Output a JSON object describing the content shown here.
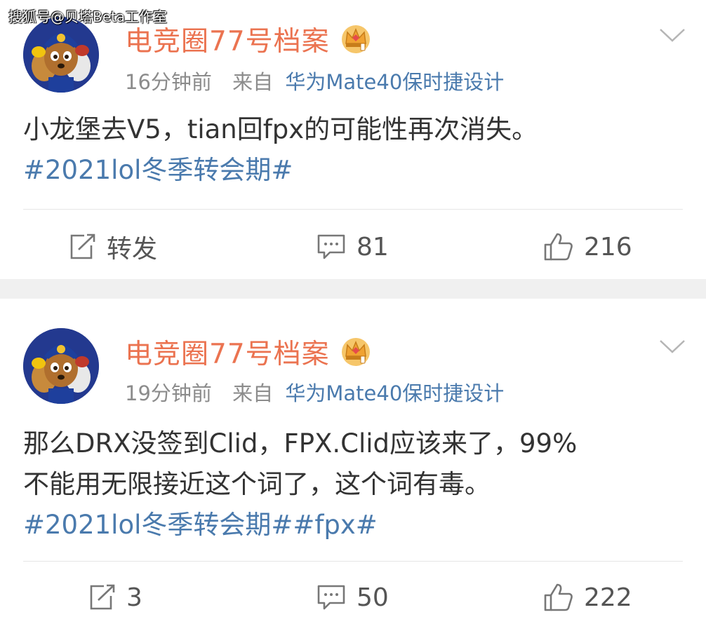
{
  "watermark": "搜狐号@贝塔Beta工作室",
  "colors": {
    "username": "#eb7350",
    "link": "#4a7aad",
    "meta_gray": "#8c8c8c",
    "separator": "#f0f0f0"
  },
  "posts": [
    {
      "username": "电竞圈77号档案",
      "time": "16分钟前",
      "from_label": "来自",
      "device": "华为Mate40保时捷设计",
      "text_lines": [
        "小龙堡去V5，tian回fpx的可能性再次消失。"
      ],
      "hashtags": "#2021lol冬季转会期#",
      "repost_label": "转发",
      "comments": "81",
      "likes": "216"
    },
    {
      "username": "电竞圈77号档案",
      "time": "19分钟前",
      "from_label": "来自",
      "device": "华为Mate40保时捷设计",
      "text_lines": [
        "那么DRX没签到Clid，FPX.Clid应该来了，99%",
        "不能用无限接近这个词了，这个词有毒。"
      ],
      "hashtags": "#2021lol冬季转会期##fpx#",
      "repost_label": "3",
      "comments": "50",
      "likes": "222"
    }
  ],
  "icons": {
    "avatar": "avatar-paw-patrol",
    "badge": "crown-icon",
    "menu": "chevron-down-icon",
    "repost": "repost-icon",
    "comment": "comment-icon",
    "like": "thumbs-up-icon"
  }
}
